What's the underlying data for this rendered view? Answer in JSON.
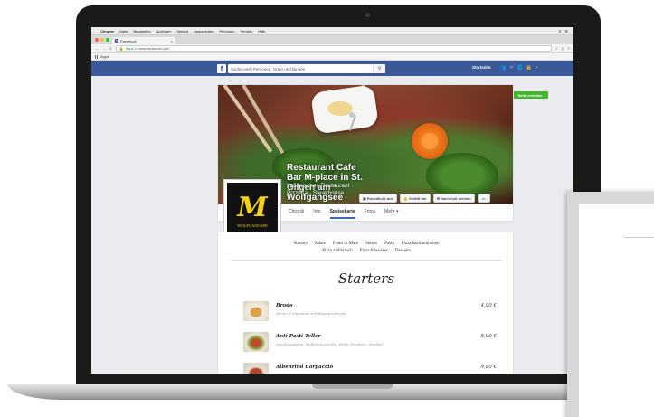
{
  "mac_menu": {
    "apple": "",
    "app_name": "Chrome",
    "items": [
      "Datei",
      "Bearbeiten",
      "Anzeigen",
      "Verlauf",
      "Lesezeichen",
      "Personen",
      "Fenster",
      "Hilfe"
    ]
  },
  "browser": {
    "tab_title": "Facebook",
    "tab_close": "×",
    "url_https": "https://",
    "url_host": "www.facebook.com",
    "apps_label": "Apps"
  },
  "facebook": {
    "logo": "f",
    "search_placeholder": "Suche nach Personen, Orten und Dingen",
    "home_label": "Startseite",
    "create_page": "Seite erstellen"
  },
  "page": {
    "name": "Restaurant Cafe Bar M-place in St. Gilgen am Wolfgangsee",
    "category": "Italienisches Restaurant · Pizzeria · Steakhouse",
    "profile_letter": "M",
    "profile_label": "WOLFGANGSEE",
    "actions": [
      {
        "label": "Rückblicke ans"
      },
      {
        "label": "Gefällt mir"
      },
      {
        "label": "Nachricht senden"
      }
    ],
    "more_label": "•••",
    "tabs": [
      "Chronik",
      "Info",
      "Speisekarte",
      "Fotos",
      "Mehr ▾"
    ],
    "active_tab": "Speisekarte"
  },
  "menu": {
    "categories_row1": [
      "Starters",
      "Salate",
      "Frutti di Mare",
      "Steaks",
      "Pasta",
      "Pizza Berühmtheiten"
    ],
    "categories_row2": [
      "Pizza süditalisch",
      "Pizza Klassiker",
      "Desserts"
    ],
    "heading": "Starters",
    "items": [
      {
        "name": "Brodo",
        "desc": "Rinder Consommé mit Rosmarinbrodo",
        "price": "4,90 €"
      },
      {
        "name": "Anti Pasti Teller",
        "desc": "Speckvariation, Büffelmozzarella, Wolfe Tomaten, Stimber",
        "price": "8,90 €"
      },
      {
        "name": "Albenrind Carpaccio",
        "desc": "",
        "price": "9,80 €"
      }
    ]
  },
  "colors": {
    "facebook_blue": "#3b5998",
    "create_green": "#42b72a",
    "logo_yellow": "#f6d20c"
  }
}
